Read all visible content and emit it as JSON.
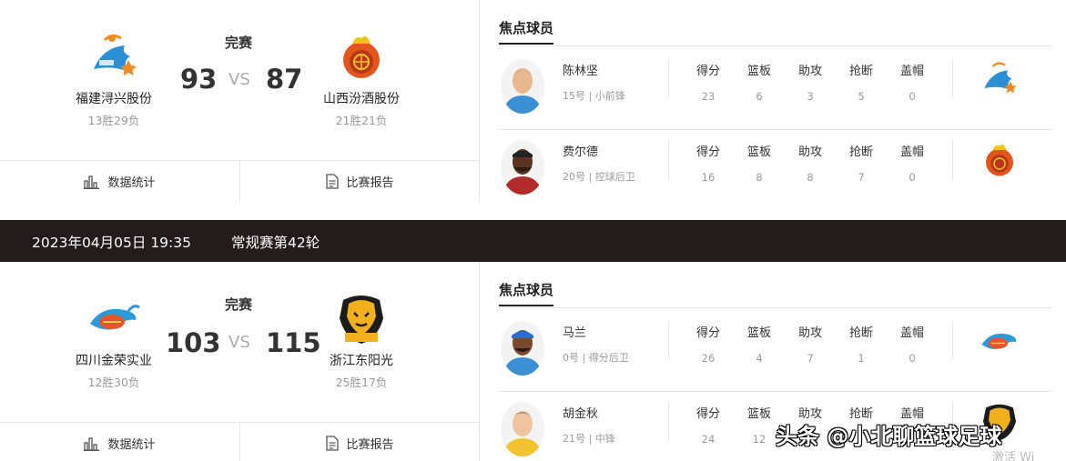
{
  "games": [
    {
      "status": "完赛",
      "home": {
        "name": "福建浔兴股份",
        "record": "13胜29负",
        "score": "93",
        "logo": "fujian-sturgeons-logo"
      },
      "away": {
        "name": "山西汾酒股份",
        "record": "21胜21负",
        "score": "87",
        "logo": "shanxi-loongs-logo"
      },
      "vs": "VS",
      "links": {
        "stats": "数据统计",
        "report": "比赛报告"
      },
      "focus_title": "焦点球员",
      "stat_labels": [
        "得分",
        "篮板",
        "助攻",
        "抢断",
        "盖帽"
      ],
      "players": [
        {
          "name": "陈林坚",
          "info": "15号 | 小前锋",
          "stats": [
            "23",
            "6",
            "3",
            "5",
            "0"
          ],
          "team_logo": "fujian-sturgeons-logo"
        },
        {
          "name": "费尔德",
          "info": "20号 | 控球后卫",
          "stats": [
            "16",
            "8",
            "8",
            "7",
            "0"
          ],
          "team_logo": "shanxi-loongs-logo"
        }
      ]
    },
    {
      "status": "完赛",
      "home": {
        "name": "四川金荣实业",
        "record": "12胜30负",
        "score": "103",
        "logo": "sichuan-blue-whales-logo"
      },
      "away": {
        "name": "浙江东阳光",
        "record": "25胜17负",
        "score": "115",
        "logo": "zhejiang-lions-logo"
      },
      "vs": "VS",
      "links": {
        "stats": "数据统计",
        "report": "比赛报告"
      },
      "focus_title": "焦点球员",
      "stat_labels": [
        "得分",
        "篮板",
        "助攻",
        "抢断",
        "盖帽"
      ],
      "players": [
        {
          "name": "马兰",
          "info": "0号 | 得分后卫",
          "stats": [
            "26",
            "4",
            "7",
            "1",
            "0"
          ],
          "team_logo": "sichuan-blue-whales-logo"
        },
        {
          "name": "胡金秋",
          "info": "21号 | 中锋",
          "stats": [
            "24",
            "12",
            "",
            "",
            ""
          ],
          "team_logo": "zhejiang-lions-logo"
        }
      ]
    }
  ],
  "round_bar": {
    "date": "2023年04月05日 19:35",
    "round": "常规赛第42轮"
  },
  "watermark": "头条 @小北聊篮球足球",
  "activate_text": "激活 Wi"
}
